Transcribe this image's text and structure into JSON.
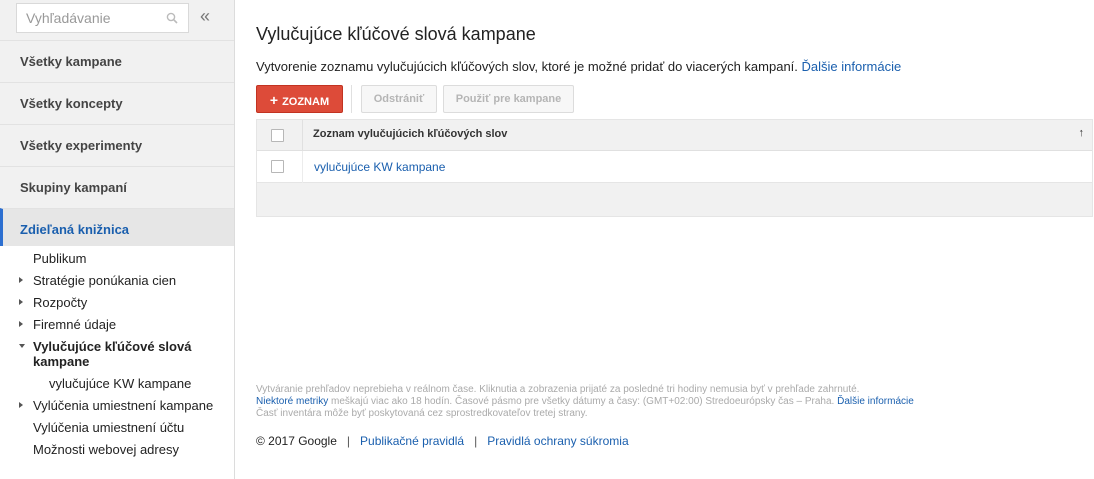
{
  "sidebar": {
    "search_placeholder": "Vyhľadávanie",
    "collapse_label": "«",
    "nav": [
      "Všetky kampane",
      "Všetky koncepty",
      "Všetky experimenty",
      "Skupiny kampaní",
      "Zdieľaná knižnica"
    ],
    "sub": [
      "Publikum",
      "Stratégie ponúkania cien",
      "Rozpočty",
      "Firemné údaje",
      "Vylučujúce kľúčové slová kampane",
      "vylučujúce KW kampane",
      "Vylúčenia umiestnení kampane",
      "Vylúčenia umiestnení účtu",
      "Možnosti webovej adresy"
    ]
  },
  "main": {
    "title": "Vylučujúce kľúčové slová kampane",
    "description": "Vytvorenie zoznamu vylučujúcich kľúčových slov, ktoré je možné pridať do viacerých kampaní.",
    "more_info": "Ďalšie informácie",
    "buttons": {
      "add": "ZOZNAM",
      "remove": "Odstrániť",
      "apply": "Použiť pre kampane"
    },
    "table": {
      "header": "Zoznam vylučujúcich kľúčových slov",
      "sort_icon": "↑",
      "rows": [
        "vylučujúce KW kampane"
      ]
    },
    "notes": {
      "line1": "Vytváranie prehľadov neprebieha v reálnom čase. Kliknutia a zobrazenia prijaté za posledné tri hodiny nemusia byť v prehľade zahrnuté.",
      "line2_link": "Niektoré metriky",
      "line2_text": " meškajú viac ako 18 hodín. Časové pásmo pre všetky dátumy a časy: (GMT+02:00) Stredoeurópsky čas – Praha.",
      "line2_more": "Ďalšie informácie",
      "line3": "Časť inventára môže byť poskytovaná cez sprostredkovateľov tretej strany."
    },
    "footer": {
      "copyright": "© 2017 Google",
      "separator": "|",
      "policy": "Publikačné pravidlá",
      "privacy": "Pravidlá ochrany súkromia"
    }
  },
  "colors": {
    "accent_red": "#dd4b39",
    "link_blue": "#1a5fae"
  }
}
